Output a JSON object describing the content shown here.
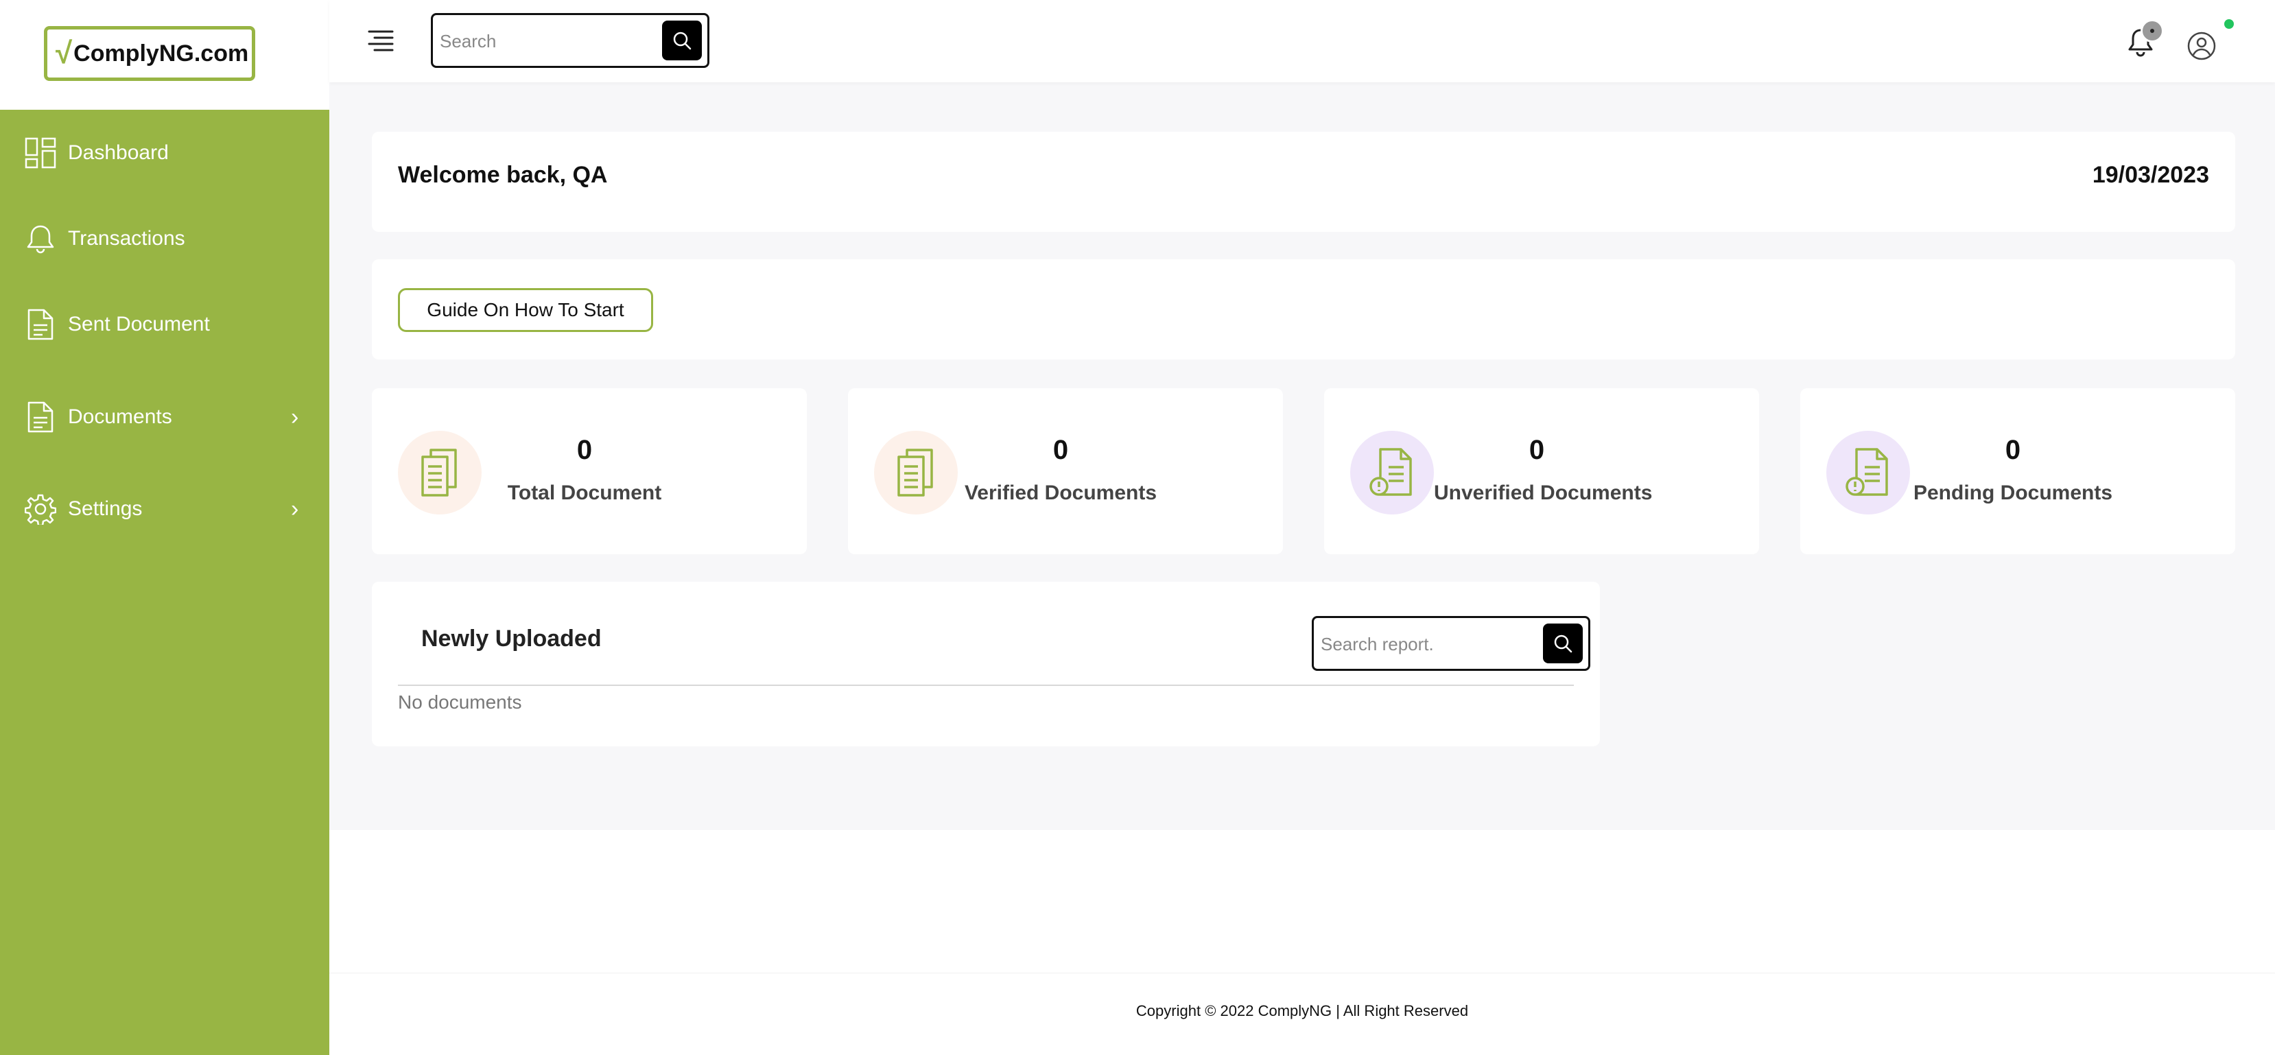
{
  "brand": {
    "logo_text": "ComplyNG.com",
    "accent_color": "#98b544"
  },
  "sidebar": {
    "items": [
      {
        "label": "Dashboard",
        "icon": "dashboard-grid-icon"
      },
      {
        "label": "Transactions",
        "icon": "bell-icon"
      },
      {
        "label": "Sent Document",
        "icon": "document-icon"
      },
      {
        "label": "Documents",
        "icon": "document-icon",
        "expandable": true
      },
      {
        "label": "Settings",
        "icon": "gear-icon",
        "expandable": true
      }
    ]
  },
  "header": {
    "search_placeholder": "Search",
    "icons": [
      "menu-icon",
      "search-icon",
      "notification-bell-icon",
      "user-avatar-icon"
    ]
  },
  "welcome": {
    "text": "Welcome back, QA",
    "date": "19/03/2023"
  },
  "guide": {
    "button_label": "Guide On How To Start"
  },
  "stats": [
    {
      "value": "0",
      "label": "Total Document",
      "icon": "documents-stack-icon",
      "circle_color": "#fdf1ea"
    },
    {
      "value": "0",
      "label": "Verified Documents",
      "icon": "documents-stack-icon",
      "circle_color": "#fdf1ea"
    },
    {
      "value": "0",
      "label": "Unverified Documents",
      "icon": "document-alert-icon",
      "circle_color": "#efe6fa"
    },
    {
      "value": "0",
      "label": "Pending Documents",
      "icon": "document-alert-icon",
      "circle_color": "#efe6fa"
    }
  ],
  "newly_uploaded": {
    "title": "Newly Uploaded",
    "search_placeholder": "Search report.",
    "empty_text": "No documents"
  },
  "footer": {
    "copyright": "Copyright © 2022 ComplyNG | All Right Reserved"
  }
}
